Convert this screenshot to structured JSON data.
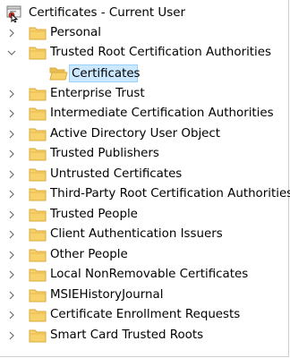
{
  "tree": {
    "root": {
      "label": "Certificates - Current User",
      "icon": "certificate-console-icon"
    },
    "items": [
      {
        "label": "Personal",
        "expanded": false
      },
      {
        "label": "Trusted Root Certification Authorities",
        "expanded": true,
        "children": [
          {
            "label": "Certificates",
            "selected": true
          }
        ]
      },
      {
        "label": "Enterprise Trust",
        "expanded": false
      },
      {
        "label": "Intermediate Certification Authorities",
        "expanded": false
      },
      {
        "label": "Active Directory User Object",
        "expanded": false
      },
      {
        "label": "Trusted Publishers",
        "expanded": false
      },
      {
        "label": "Untrusted Certificates",
        "expanded": false
      },
      {
        "label": "Third-Party Root Certification Authorities",
        "expanded": false
      },
      {
        "label": "Trusted People",
        "expanded": false
      },
      {
        "label": "Client Authentication Issuers",
        "expanded": false
      },
      {
        "label": "Other People",
        "expanded": false
      },
      {
        "label": "Local NonRemovable Certificates",
        "expanded": false
      },
      {
        "label": "MSIEHistoryJournal",
        "expanded": false
      },
      {
        "label": "Certificate Enrollment Requests",
        "expanded": false
      },
      {
        "label": "Smart Card Trusted Roots",
        "expanded": false
      }
    ]
  },
  "colors": {
    "folder_fill": "#f7d26b",
    "folder_edge": "#d9a93b",
    "selection_bg": "#cce8ff",
    "selection_border": "#99d1ff",
    "chevron": "#6d6d6d"
  }
}
